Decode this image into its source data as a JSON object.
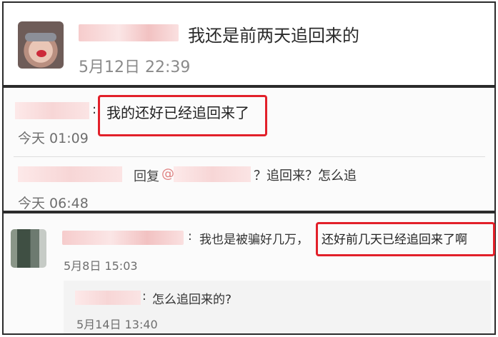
{
  "post": {
    "message": "我还是前两天追回来的",
    "timestamp": "5月12日 22:39"
  },
  "thread1": {
    "comment1": {
      "sep": ":",
      "text": "我的还好已经追回来了",
      "time": "今天 01:09"
    },
    "comment2": {
      "reply_label": "回复",
      "at": "@",
      "text": "？追回来？怎么追",
      "time": "今天 06:48"
    }
  },
  "thread2": {
    "comment": {
      "sep": ":",
      "text_a": "我也是被骗好几万，",
      "text_b": "还好前几天已经追回来了啊",
      "time": "5月8日 15:03"
    },
    "reply": {
      "sep": ":",
      "text": "怎么追回来的?",
      "time": "5月14日 13:40"
    }
  },
  "colors": {
    "highlight": "#e2202a",
    "border": "#2b2b2b",
    "timestamp": "#6e6e6e"
  }
}
